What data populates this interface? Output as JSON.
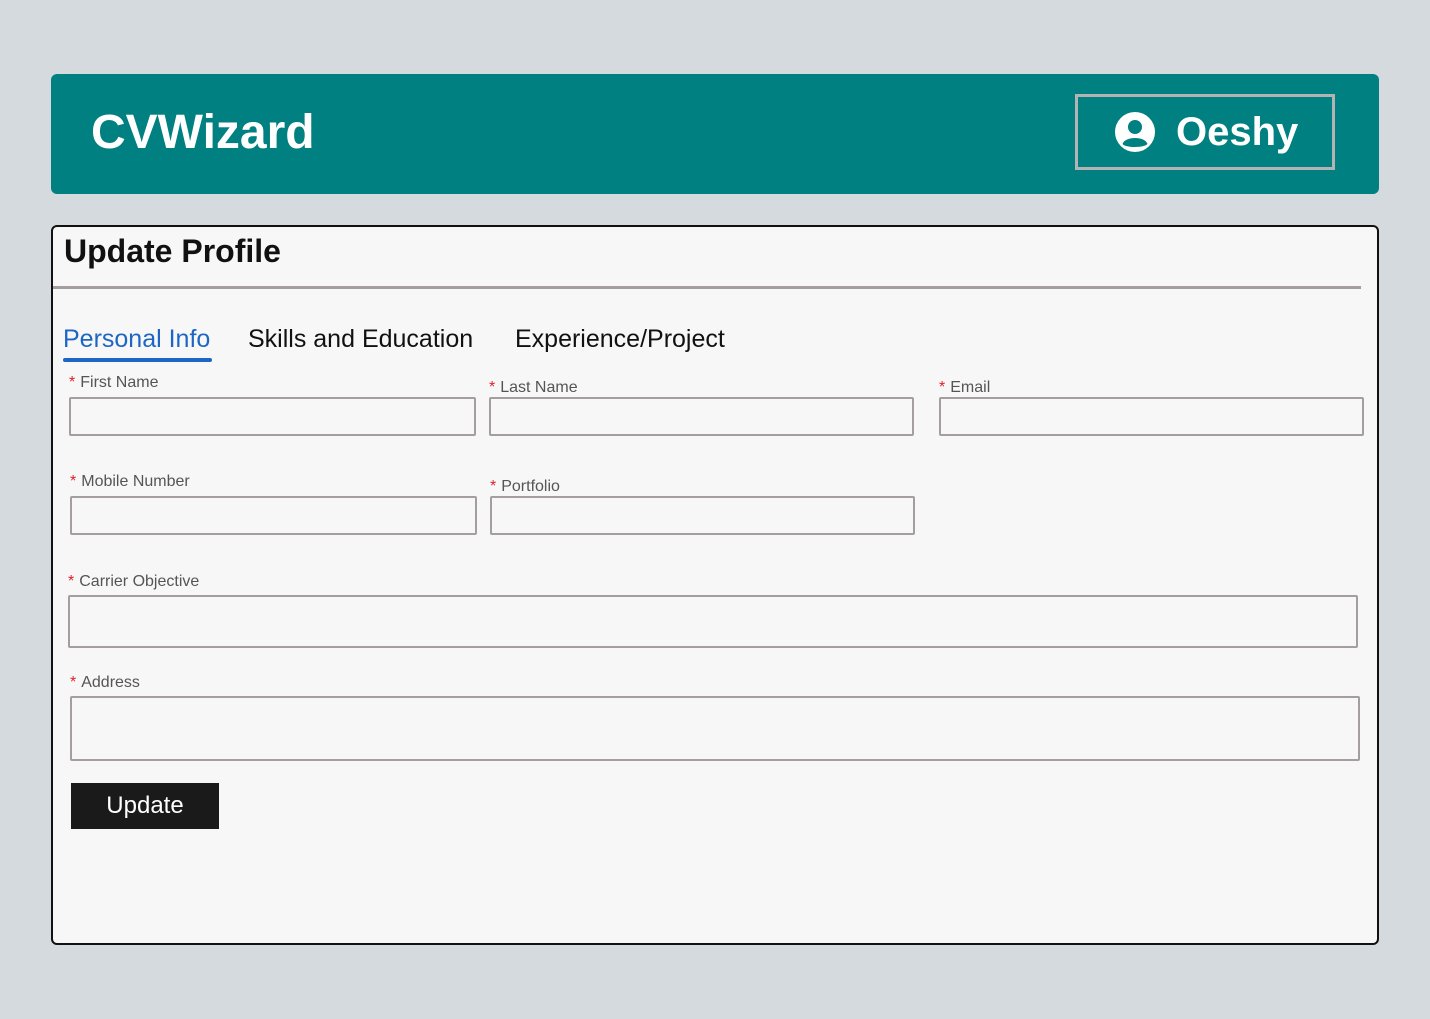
{
  "header": {
    "brand": "CVWizard",
    "user": {
      "name": "Oeshy",
      "icon": "user-circle-icon"
    },
    "background_color": "#008080"
  },
  "card": {
    "title": "Update Profile",
    "tabs": [
      {
        "label": "Personal Info",
        "active": true
      },
      {
        "label": "Skills and Education",
        "active": false
      },
      {
        "label": "Experience/Project",
        "active": false
      }
    ],
    "fields": {
      "first_name": {
        "label": "First Name",
        "required_marker": "*",
        "value": ""
      },
      "last_name": {
        "label": "Last Name",
        "required_marker": "*",
        "value": ""
      },
      "email": {
        "label": "Email",
        "required_marker": "*",
        "value": ""
      },
      "mobile_number": {
        "label": "Mobile Number",
        "required_marker": "*",
        "value": ""
      },
      "portfolio": {
        "label": "Portfolio",
        "required_marker": "*",
        "value": ""
      },
      "carrier_objective": {
        "label": "Carrier Objective",
        "required_marker": "*",
        "value": ""
      },
      "address": {
        "label": "Address",
        "required_marker": "*",
        "value": ""
      }
    },
    "submit_label": "Update"
  },
  "colors": {
    "accent": "#1e66c4",
    "required": "#e0202a",
    "button": "#1a1a1a"
  }
}
